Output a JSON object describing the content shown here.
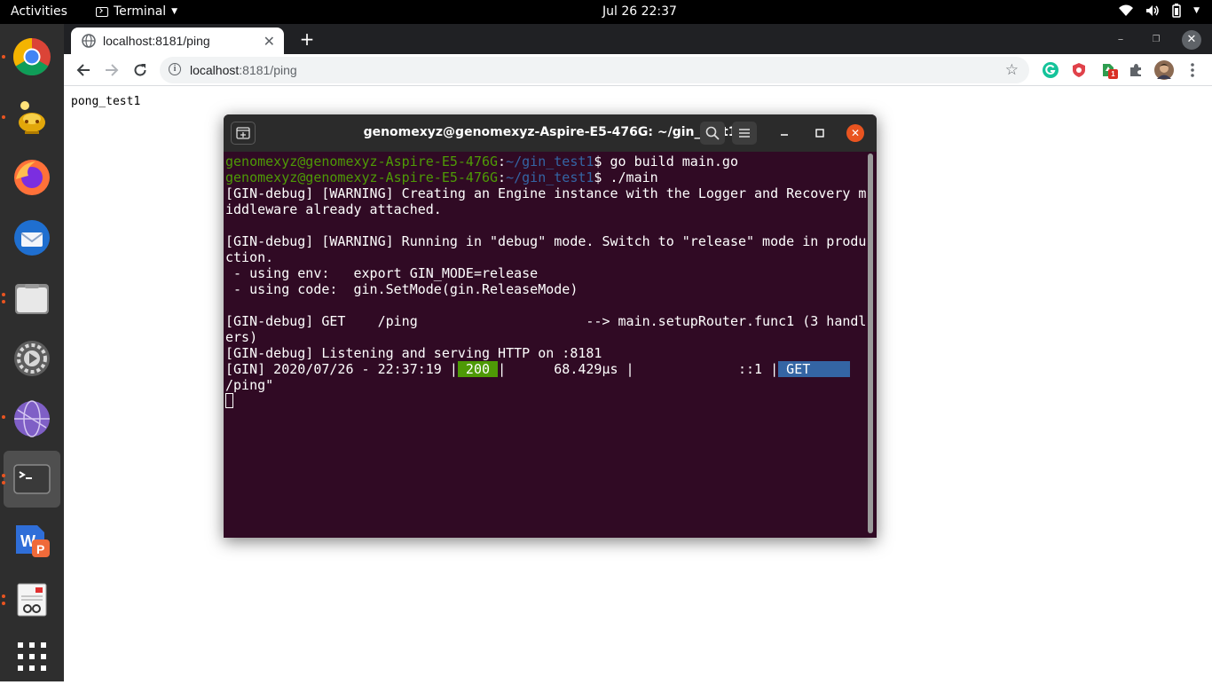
{
  "topbar": {
    "activities": "Activities",
    "app_name": "Terminal",
    "clock": "Jul 26  22:37"
  },
  "dock": {
    "apps": [
      "chrome-icon",
      "lamp-icon",
      "firefox-icon",
      "thunderbird-icon",
      "files-icon",
      "settings-icon",
      "network-globe-icon",
      "terminal-icon",
      "wps-presentation-icon",
      "document-viewer-icon",
      "show-apps-grid-icon"
    ]
  },
  "browser": {
    "tab_title": "localhost:8181/ping",
    "url_host": "localhost",
    "url_rest": ":8181/ping",
    "page_text": "pong_test1",
    "extension_badge": "1"
  },
  "terminal": {
    "title": "genomexyz@genomexyz-Aspire-E5-476G: ~/gin_test1",
    "prompt_user": "genomexyz@genomexyz-Aspire-E5-476G",
    "prompt_path": "~/gin_test1",
    "cmd1": "go build main.go",
    "cmd2": "./main",
    "line_warn1a": "[GIN-debug] [WARNING] Creating an Engine instance with the Logger and Recovery m",
    "line_warn1b": "iddleware already attached.",
    "line_warn2a": "[GIN-debug] [WARNING] Running in \"debug\" mode. Switch to \"release\" mode in produ",
    "line_warn2b": "ction.",
    "line_env": " - using env:   export GIN_MODE=release",
    "line_code": " - using code:  gin.SetMode(gin.ReleaseMode)",
    "line_route_a": "[GIN-debug] GET    /ping                     --> main.setupRouter.func1 (3 handl",
    "line_route_b": "ers)",
    "line_listen": "[GIN-debug] Listening and serving HTTP on :8181",
    "log_prefix": "[GIN] 2020/07/26 - 22:37:19 |",
    "log_status": " 200 ",
    "log_mid": "|      68.429µs |             ::1 |",
    "log_method": " GET     ",
    "log_tail": "  \"",
    "log_path": "/ping\""
  }
}
